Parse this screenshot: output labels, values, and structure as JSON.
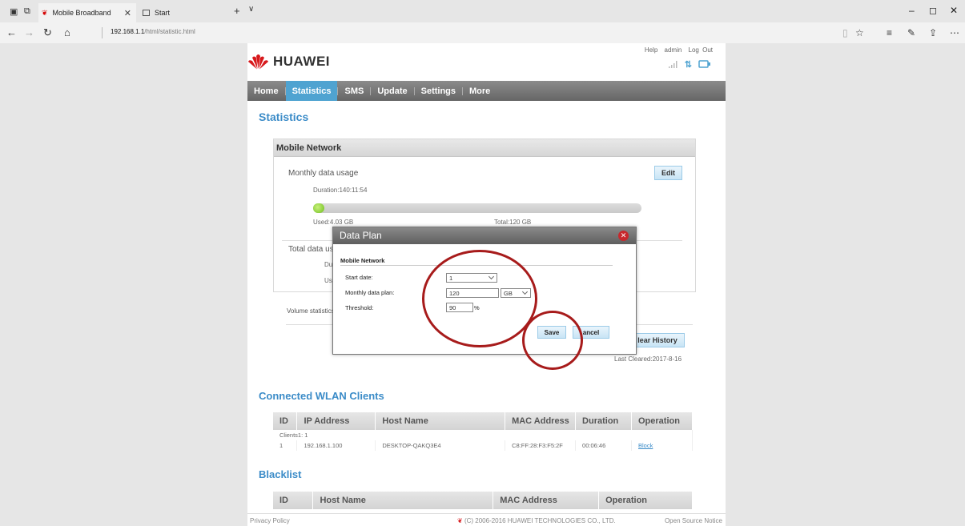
{
  "browser": {
    "tabs": [
      {
        "label": "Mobile Broadband",
        "active": true
      },
      {
        "label": "Start",
        "active": false
      }
    ],
    "url_host": "192.168.1.1",
    "url_path": "/html/statistic.html"
  },
  "header": {
    "brand": "HUAWEI",
    "links": [
      "Help",
      "admin",
      "Log Out"
    ]
  },
  "nav": {
    "items": [
      "Home",
      "Statistics",
      "SMS",
      "Update",
      "Settings",
      "More"
    ],
    "active": "Statistics"
  },
  "page_title": "Statistics",
  "mobile_network": {
    "title": "Mobile Network",
    "monthly_label": "Monthly data usage",
    "edit_label": "Edit",
    "duration": "Duration:140:11:54",
    "used": "Used:4.03 GB",
    "total": "Total:120 GB",
    "usage_fraction": 0.034,
    "total_label": "Total data usa",
    "row_du": "Du",
    "row_us": "Us"
  },
  "volume_label": "Volume statistics",
  "clear_history_label": "Clear History",
  "clear_history_visible": "lear History",
  "last_cleared": "Last Cleared:2017-8-16",
  "wlan": {
    "title": "Connected WLAN Clients",
    "headers": [
      "ID",
      "IP Address",
      "Host Name",
      "MAC Address",
      "Duration",
      "Operation"
    ],
    "clients_line": "Clients1: 1",
    "rows": [
      {
        "id": "1",
        "ip": "192.168.1.100",
        "host": "DESKTOP-QAKQ3E4",
        "mac": "C8:FF:28:F3:F5:2F",
        "duration": "00:06:46",
        "op": "Block"
      }
    ]
  },
  "blacklist": {
    "title": "Blacklist",
    "headers": [
      "ID",
      "Host Name",
      "MAC Address",
      "Operation"
    ]
  },
  "footer": {
    "privacy": "Privacy Policy",
    "copyright": "(C) 2006-2016 HUAWEI TECHNOLOGIES CO., LTD.",
    "open_source": "Open Source Notice"
  },
  "dialog": {
    "title": "Data Plan",
    "section": "Mobile Network",
    "start_date_label": "Start date:",
    "start_date_value": "1",
    "monthly_plan_label": "Monthly data plan:",
    "monthly_plan_value": "120",
    "monthly_plan_unit": "GB",
    "threshold_label": "Threshold:",
    "threshold_value": "90",
    "threshold_unit": "%",
    "save_label": "Save",
    "cancel_label": "Cancel",
    "cancel_visible": "ancel"
  },
  "colors": {
    "accent": "#3c8cc8",
    "annotation": "#a71b1b",
    "progress": "#6fbf1f"
  }
}
